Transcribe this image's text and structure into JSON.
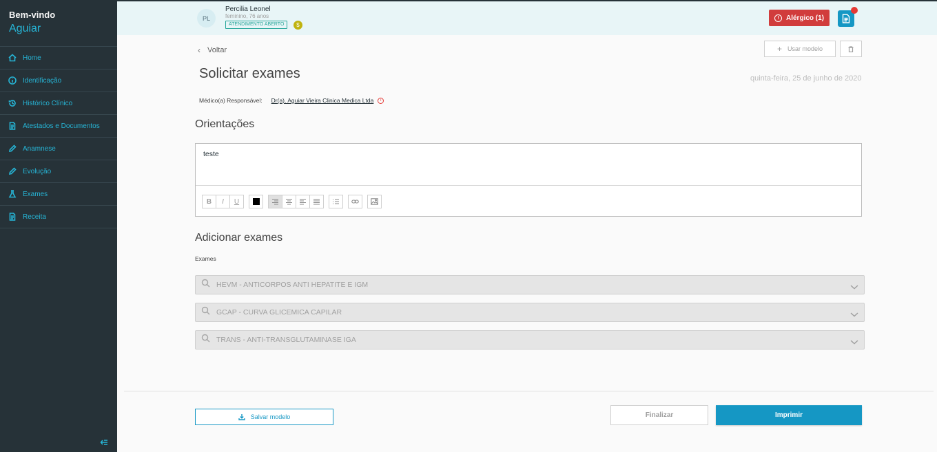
{
  "sidebar": {
    "welcome": "Bem-vindo",
    "user": "Aguiar",
    "items": [
      {
        "label": "Home",
        "icon": "home-icon"
      },
      {
        "label": "Identificação",
        "icon": "info-icon"
      },
      {
        "label": "Histórico Clínico",
        "icon": "history-icon"
      },
      {
        "label": "Atestados e Documentos",
        "icon": "document-icon"
      },
      {
        "label": "Anamnese",
        "icon": "pencil-icon"
      },
      {
        "label": "Evolução",
        "icon": "pencil-icon"
      },
      {
        "label": "Exames",
        "icon": "flask-icon"
      },
      {
        "label": "Receita",
        "icon": "document-icon"
      }
    ]
  },
  "patient": {
    "initials": "PL",
    "name": "Percilia Leonel",
    "info": "feminino, 76 anos",
    "status": "ATENDIMENTO ABERTO",
    "coin_symbol": "$"
  },
  "header": {
    "allergic_label": "Alérgico (1)",
    "allergic_icon": "!"
  },
  "page": {
    "back_label": "Voltar",
    "use_model_label": "Usar modelo",
    "title": "Solicitar exames",
    "date": "quinta-feira, 25 de junho de 2020",
    "responsible_label": "Médico(a) Responsável:",
    "responsible_doctor": "Dr(a). Aguiar Vieira Clinica Medica Ltda",
    "warn_symbol": "i",
    "orientations_heading": "Orientações",
    "editor_text": "teste",
    "toolbar": {
      "bold": "B",
      "italic": "I",
      "underline": "U"
    },
    "add_heading": "Adicionar exames",
    "exams_label": "Exames",
    "exams": [
      "HEVM - ANTICORPOS ANTI HEPATITE E IGM",
      "GCAP - CURVA GLICEMICA CAPILAR",
      "TRANS - ANTI-TRANSGLUTAMINASE IGA"
    ]
  },
  "footer": {
    "save_model_label": "Salvar modelo",
    "finalize_label": "Finalizar",
    "print_label": "Imprimir"
  },
  "colors": {
    "sidebar_bg": "#263238",
    "accent": "#1597c4",
    "sidebar_text": "#26b5d6",
    "alert": "#d13c3c",
    "status": "#26a69a"
  }
}
